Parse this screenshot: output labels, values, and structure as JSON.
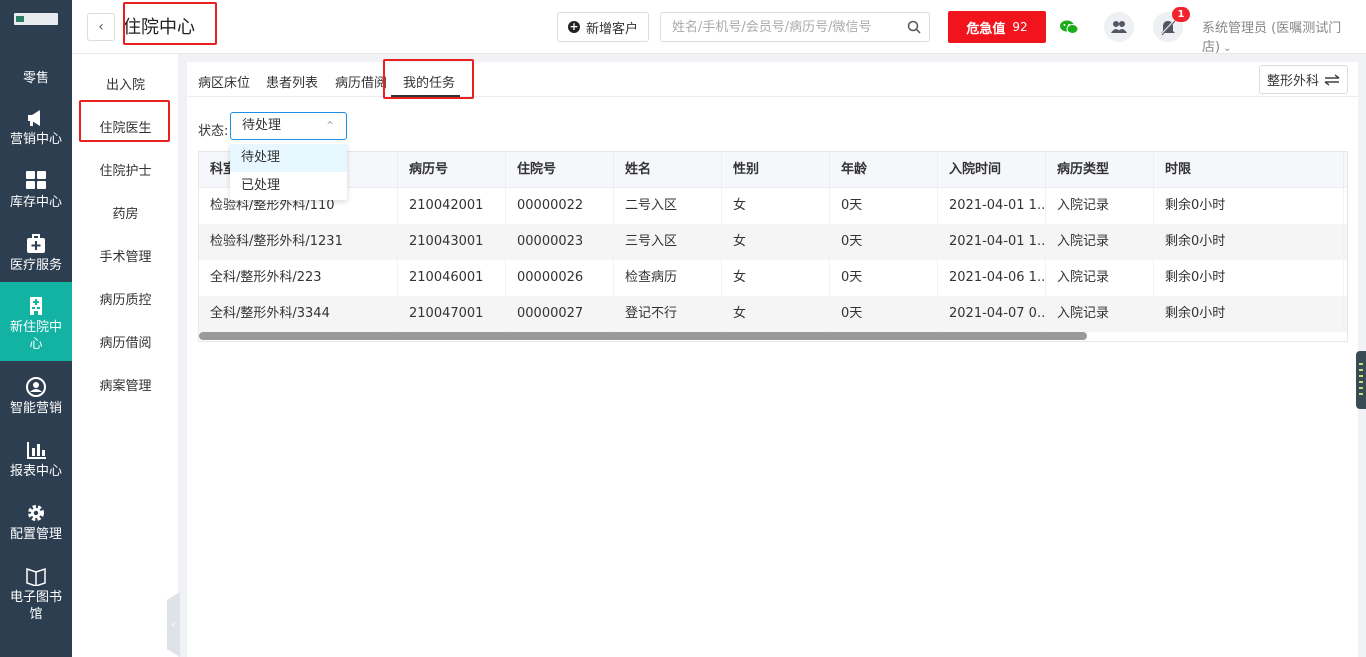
{
  "sidebar": {
    "items": [
      {
        "label": "零售",
        "icon": "none"
      },
      {
        "label": "营销中心",
        "icon": "megaphone-icon"
      },
      {
        "label": "库存中心",
        "icon": "grid-icon"
      },
      {
        "label": "医疗服务",
        "icon": "medical-kit-icon"
      },
      {
        "label": "新住院中心",
        "icon": "hospital-icon"
      },
      {
        "label": "智能营销",
        "icon": "people-icon"
      },
      {
        "label": "报表中心",
        "icon": "bar-chart-icon"
      },
      {
        "label": "配置管理",
        "icon": "gear-icon"
      },
      {
        "label": "电子图书馆",
        "icon": "book-icon"
      }
    ],
    "active_index": 4,
    "active_color": "#13b3a3",
    "bg_color": "#2c3e50"
  },
  "header": {
    "title": "住院中心",
    "add_customer_label": "新增客户",
    "search_placeholder": "姓名/手机号/会员号/病历号/微信号",
    "critical_label": "危急值",
    "critical_count": "92",
    "critical_color": "#f2141c",
    "notification_count": "1",
    "user_label": "系统管理员 (医嘱测试门店)"
  },
  "subnav": {
    "items": [
      "出入院",
      "住院医生",
      "住院护士",
      "药房",
      "手术管理",
      "病历质控",
      "病历借阅",
      "病案管理"
    ],
    "selected_index": 1
  },
  "tabs": {
    "items": [
      "病区床位",
      "患者列表",
      "病历借阅",
      "我的任务"
    ],
    "active_index": 3
  },
  "dept_button_label": "整形外科",
  "filter": {
    "status_label": "状态:",
    "status_value": "待处理",
    "options": [
      "待处理",
      "已处理"
    ],
    "highlighted_option": 0
  },
  "table": {
    "columns": [
      "科室",
      "病历号",
      "住院号",
      "姓名",
      "性别",
      "年龄",
      "入院时间",
      "病历类型",
      "时限"
    ],
    "rows": [
      [
        "检验科/整形外科/110",
        "210042001",
        "00000022",
        "二号入区",
        "女",
        "0天",
        "2021-04-01 1...",
        "入院记录",
        "剩余0小时"
      ],
      [
        "检验科/整形外科/1231",
        "210043001",
        "00000023",
        "三号入区",
        "女",
        "0天",
        "2021-04-01 1...",
        "入院记录",
        "剩余0小时"
      ],
      [
        "全科/整形外科/223",
        "210046001",
        "00000026",
        "检查病历",
        "女",
        "0天",
        "2021-04-06 1...",
        "入院记录",
        "剩余0小时"
      ],
      [
        "全科/整形外科/3344",
        "210047001",
        "00000027",
        "登记不行",
        "女",
        "0天",
        "2021-04-07 0...",
        "入院记录",
        "剩余0小时"
      ]
    ]
  }
}
